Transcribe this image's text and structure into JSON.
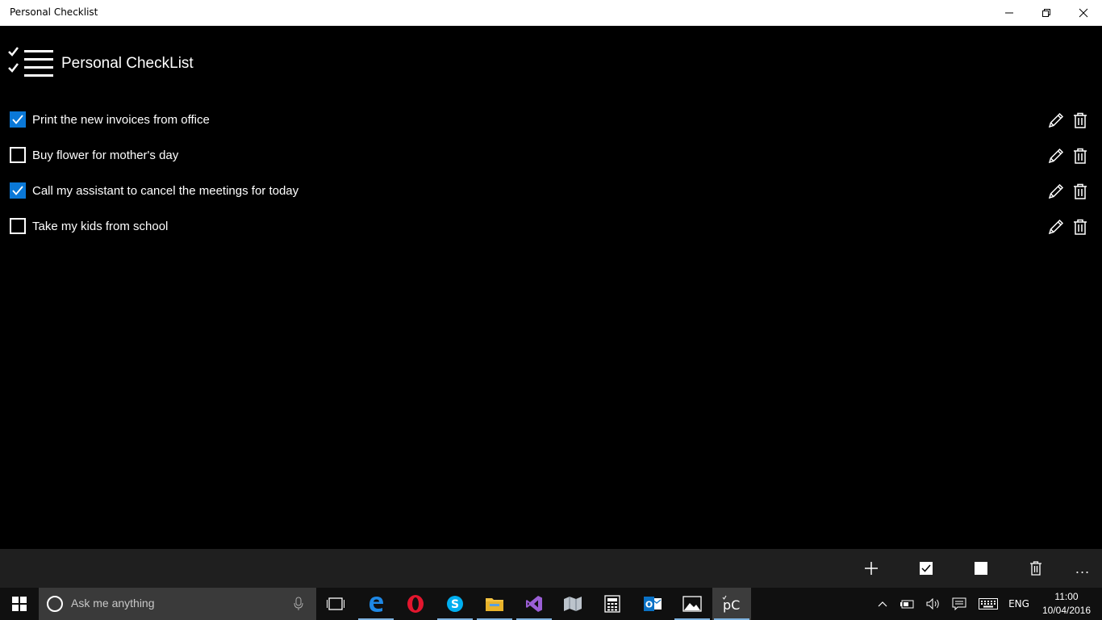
{
  "window": {
    "title": "Personal Checklist",
    "controls": [
      "minimize-icon",
      "restore-icon",
      "close-icon"
    ]
  },
  "app": {
    "title": "Personal CheckList",
    "logo_icon": "checklist-logo-icon"
  },
  "tasks": [
    {
      "label": "Print the new invoices from office",
      "checked": true
    },
    {
      "label": "Buy flower for mother's day",
      "checked": false
    },
    {
      "label": "Call my assistant to cancel the meetings for today",
      "checked": true
    },
    {
      "label": "Take my kids from school",
      "checked": false
    }
  ],
  "command_bar": {
    "buttons": [
      "add-icon",
      "check-all-icon",
      "uncheck-all-icon",
      "delete-icon",
      "more-icon"
    ],
    "more_label": "..."
  },
  "taskbar": {
    "search_placeholder": "Ask me anything",
    "apps": [
      "task-view",
      "edge",
      "opera",
      "skype",
      "file-explorer",
      "visual-studio",
      "maps",
      "calculator",
      "outlook",
      "photos",
      "personal-checklist"
    ],
    "language": "ENG",
    "time": "11:00",
    "date": "10/04/2016"
  },
  "colors": {
    "accent": "#0a78d7",
    "background": "#000000",
    "command_bar": "#1f1f1f",
    "taskbar": "#101010"
  }
}
